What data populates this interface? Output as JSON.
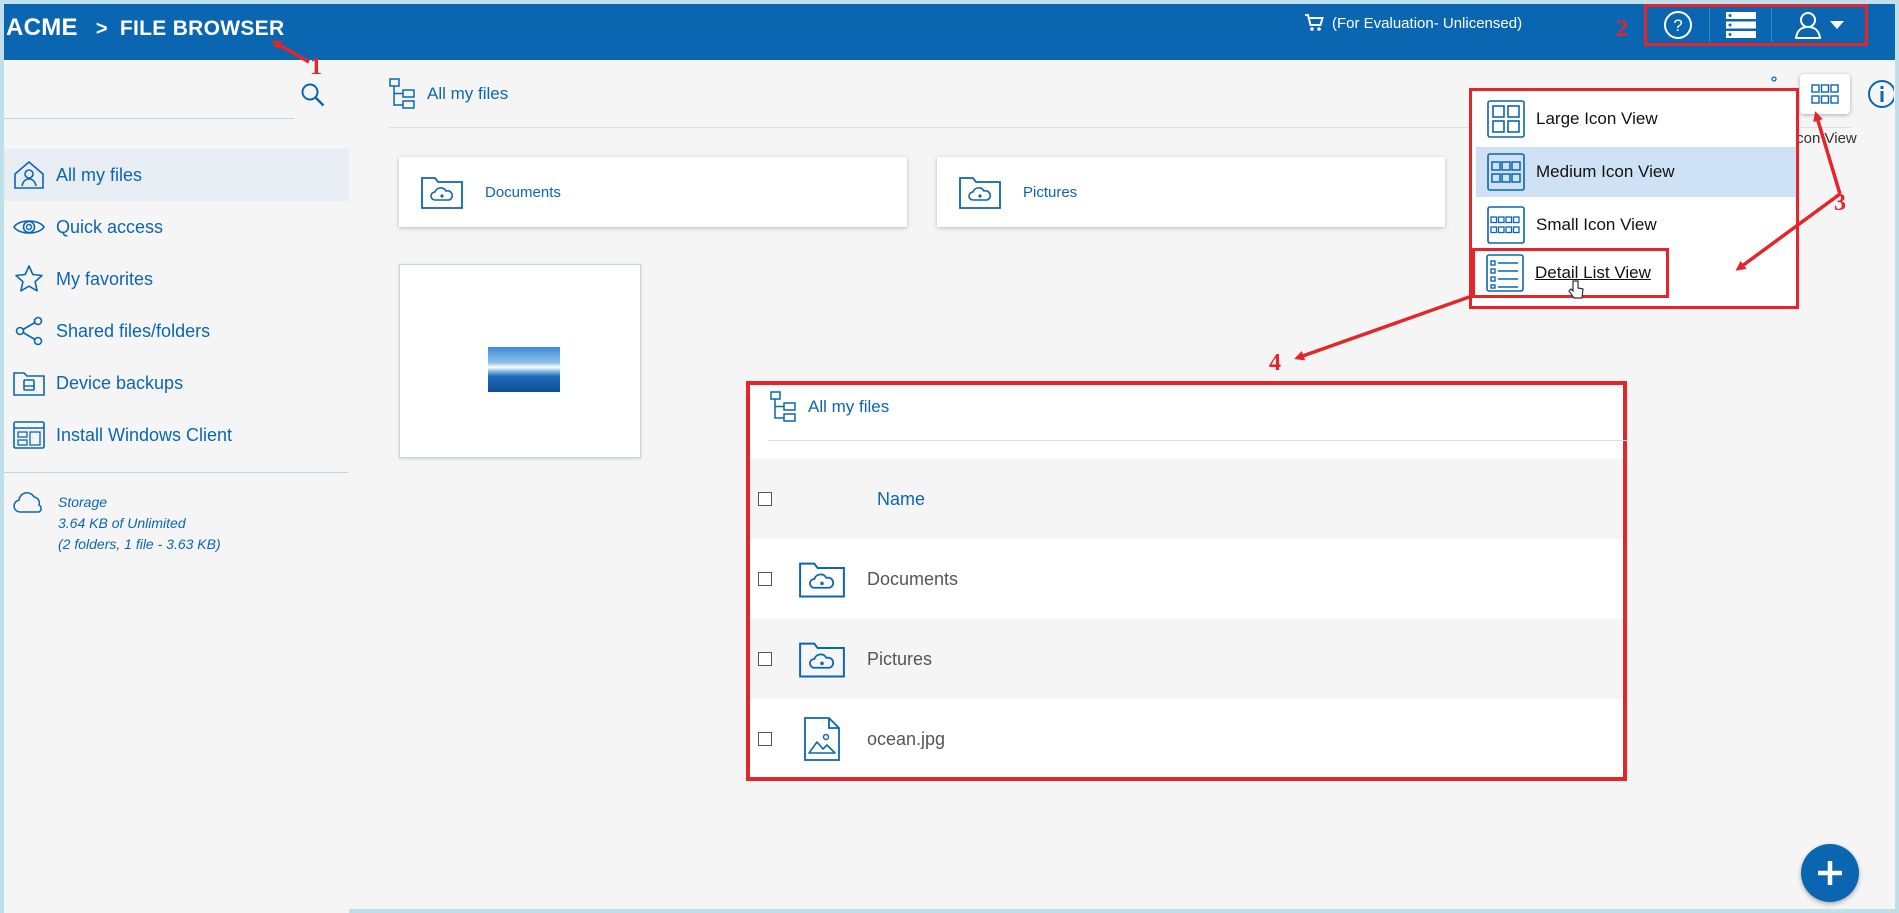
{
  "header": {
    "brand": "ACME",
    "separator": ">",
    "section": "FILE BROWSER",
    "evaluation_text": "(For Evaluation- Unlicensed)"
  },
  "sidebar": {
    "items": [
      {
        "label": "All my files",
        "icon": "home-user-icon"
      },
      {
        "label": "Quick access",
        "icon": "eye-icon"
      },
      {
        "label": "My favorites",
        "icon": "star-icon"
      },
      {
        "label": "Shared files/folders",
        "icon": "share-icon"
      },
      {
        "label": "Device backups",
        "icon": "device-backup-icon"
      },
      {
        "label": "Install Windows Client",
        "icon": "windows-client-icon"
      }
    ],
    "storage": {
      "title": "Storage",
      "usage": "3.64 KB of Unlimited",
      "summary": "(2 folders, 1 file - 3.63 KB)"
    }
  },
  "main": {
    "breadcrumb": "All my files",
    "folders": [
      "Documents",
      "Pictures"
    ],
    "tooltip": "Icon View"
  },
  "view_menu": {
    "items": [
      "Large Icon View",
      "Medium Icon View",
      "Small Icon View",
      "Detail List View"
    ],
    "selected": "Medium Icon View"
  },
  "detail_view": {
    "breadcrumb": "All my files",
    "column_name": "Name",
    "rows": [
      "Documents",
      "Pictures",
      "ocean.jpg"
    ]
  },
  "annotations": [
    "1",
    "2",
    "3",
    "4"
  ],
  "colors": {
    "brand_blue": "#0b66b2",
    "annotation_red": "#e3262b",
    "selected_bg": "#cfe2f5"
  }
}
